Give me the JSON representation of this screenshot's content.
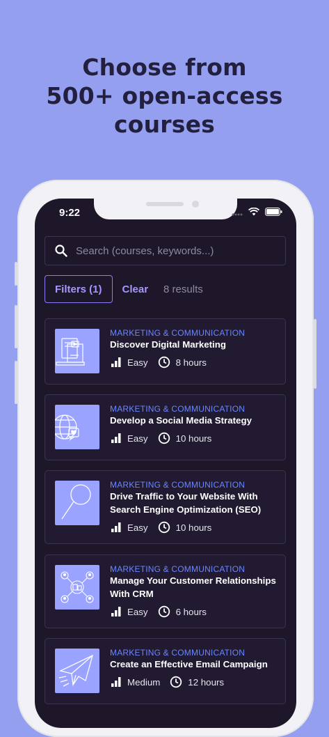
{
  "headline": {
    "line1": "Choose from",
    "line2": "500+ open-access",
    "line3": "courses"
  },
  "status_bar": {
    "time": "9:22"
  },
  "search": {
    "placeholder": "Search (courses, keywords...)"
  },
  "filters": {
    "filters_label": "Filters (1)",
    "clear_label": "Clear",
    "results_label": "8 results"
  },
  "courses": [
    {
      "category": "MARKETING & COMMUNICATION",
      "title": "Discover Digital Marketing",
      "level": "Easy",
      "duration": "8 hours",
      "icon": "laptop-icon"
    },
    {
      "category": "MARKETING & COMMUNICATION",
      "title": "Develop a Social Media Strategy",
      "level": "Easy",
      "duration": "10 hours",
      "icon": "globe-heart-icon"
    },
    {
      "category": "MARKETING & COMMUNICATION",
      "title": "Drive Traffic to Your Website With Search Engine Optimization (SEO)",
      "level": "Easy",
      "duration": "10 hours",
      "icon": "magnifier-icon"
    },
    {
      "category": "MARKETING & COMMUNICATION",
      "title": "Manage Your Customer Relationships With CRM",
      "level": "Easy",
      "duration": "6 hours",
      "icon": "network-icon"
    },
    {
      "category": "MARKETING & COMMUNICATION",
      "title": "Create an Effective Email Campaign",
      "level": "Medium",
      "duration": "12 hours",
      "icon": "paper-plane-icon"
    }
  ],
  "colors": {
    "background": "#959ff0",
    "screen": "#1d1729",
    "accent": "#a896ff",
    "category": "#6a86ff",
    "thumbnail": "#9aa3ff"
  }
}
